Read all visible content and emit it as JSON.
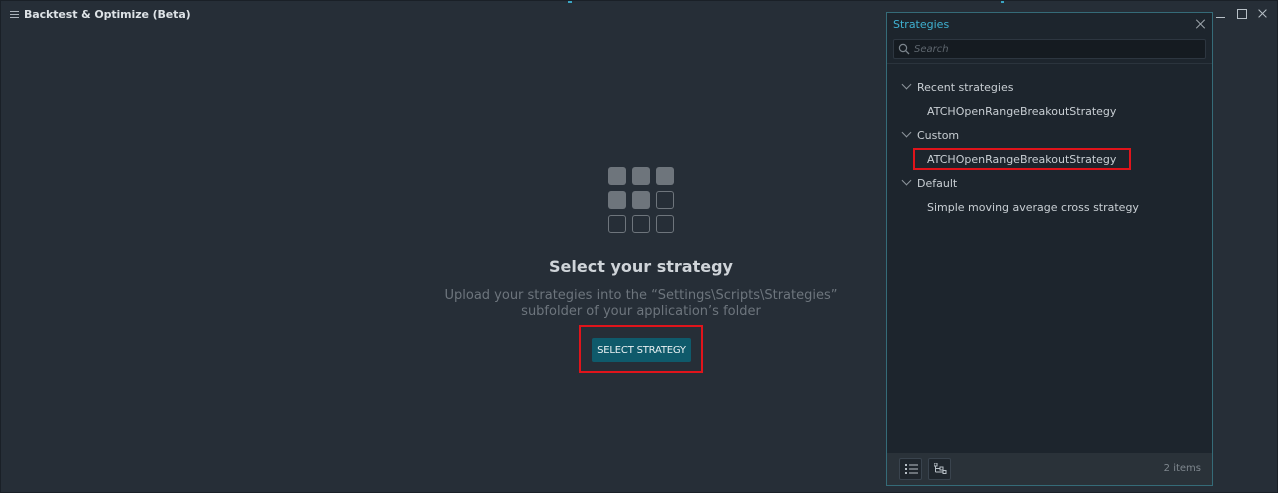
{
  "window": {
    "title": "Backtest & Optimize (Beta)"
  },
  "empty_state": {
    "title": "Select your strategy",
    "description_line1": "Upload your strategies into the “Settings\\Scripts\\Strategies”",
    "description_line2": "subfolder of your application’s folder",
    "button_label": "SELECT STRATEGY"
  },
  "strategies_panel": {
    "title": "Strategies",
    "search_placeholder": "Search",
    "groups": [
      {
        "label": "Recent strategies",
        "items": [
          "ATCHOpenRangeBreakoutStrategy"
        ]
      },
      {
        "label": "Custom",
        "items": [
          "ATCHOpenRangeBreakoutStrategy"
        ]
      },
      {
        "label": "Default",
        "items": [
          "Simple moving average cross strategy"
        ]
      }
    ],
    "item_count": "2 items"
  },
  "colors": {
    "background": "#262e37",
    "panel_background": "#1d252d",
    "accent": "#3fb1d1",
    "button": "#0f5a6b",
    "highlight_box": "#e0141b"
  }
}
